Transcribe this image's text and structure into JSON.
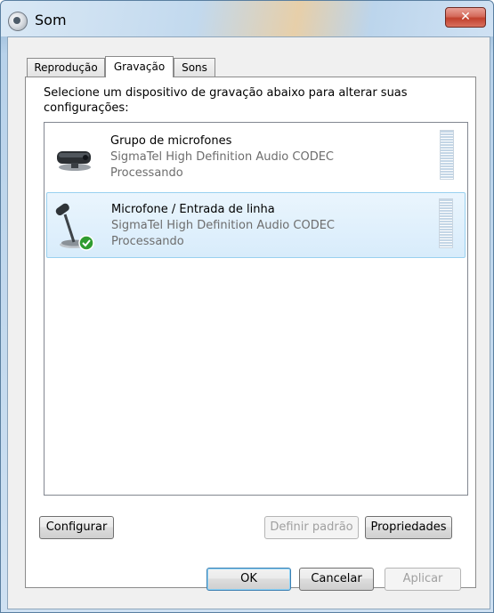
{
  "window": {
    "title": "Som",
    "close_symbol": "✕"
  },
  "tabs": [
    {
      "label": "Reprodução",
      "active": false
    },
    {
      "label": "Gravação",
      "active": true
    },
    {
      "label": "Sons",
      "active": false
    }
  ],
  "panel": {
    "instructions": "Selecione um dispositivo de gravação abaixo para alterar suas configurações:"
  },
  "devices": [
    {
      "name": "Grupo de microfones",
      "driver": "SigmaTel High Definition Audio CODEC",
      "status": "Processando",
      "icon": "microphone-array-icon",
      "selected": false,
      "default": false
    },
    {
      "name": "Microfone / Entrada de linha",
      "driver": "SigmaTel High Definition Audio CODEC",
      "status": "Processando",
      "icon": "desk-microphone-icon",
      "selected": true,
      "default": true
    }
  ],
  "panel_buttons": {
    "configure": "Configurar",
    "set_default": "Definir padrão",
    "properties": "Propriedades"
  },
  "dialog_buttons": {
    "ok": "OK",
    "cancel": "Cancelar",
    "apply": "Aplicar"
  }
}
